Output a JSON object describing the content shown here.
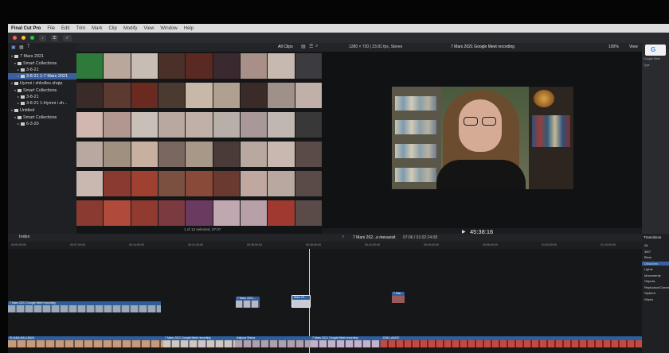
{
  "menubar": {
    "app": "Final Cut Pro",
    "items": [
      "File",
      "Edit",
      "Trim",
      "Mark",
      "Clip",
      "Modify",
      "View",
      "Window",
      "Help"
    ]
  },
  "libraries": [
    {
      "label": "7 Mars 2021",
      "type": "library",
      "selected": false
    },
    {
      "label": "Smart Collections",
      "type": "folder",
      "selected": false
    },
    {
      "label": "3-8-21",
      "type": "event",
      "selected": false
    },
    {
      "label": "3-8-21 1-7 Mars 2021",
      "type": "event",
      "selected": true
    },
    {
      "label": "Hymni i shkolles shqip",
      "type": "library",
      "selected": false
    },
    {
      "label": "Smart Collections",
      "type": "folder",
      "selected": false
    },
    {
      "label": "3-8-21",
      "type": "event",
      "selected": false
    },
    {
      "label": "3-8-21 1-Hymni i sh...",
      "type": "event",
      "selected": false
    },
    {
      "label": "Untitled",
      "type": "library",
      "selected": false
    },
    {
      "label": "Smart Collections",
      "type": "folder",
      "selected": false
    },
    {
      "label": "6-3-20",
      "type": "event",
      "selected": false
    }
  ],
  "browser": {
    "filter": "All Clips",
    "selection_status": "1 of 13 selected, 07:07"
  },
  "viewer": {
    "format": "1280 × 720 | 23.81 fps, Stereo",
    "title": "7 Mars 2021 Google Meet recording",
    "zoom": "100%",
    "view": "View",
    "timecode": "45:38:16"
  },
  "inspector": {
    "label1": "Google Meet",
    "label2": "Type"
  },
  "timeline": {
    "index": "Index",
    "project": "7 Mars 202...a mesuesit",
    "duration": "07:06 / 01:02:24:08",
    "ruler": [
      "00:00:00:00",
      "00:07:00:00",
      "00:14:00:00",
      "00:21:00:00",
      "00:28:00:00",
      "00:35:00:00",
      "00:42:00:00",
      "00:49:00:00",
      "00:56:00:00",
      "01:03:00:00",
      "01:10:00:00"
    ],
    "clips": [
      {
        "label": "7 Mars 2021 Google Meet recording",
        "color": "#2f5f9a"
      },
      {
        "label": "7 Mars 2021...",
        "color": "#2f5f9a"
      },
      {
        "label": "Mars 20...",
        "color": "#2f5f9a"
      },
      {
        "label": "7 Mar...",
        "color": "#2f5f9a"
      },
      {
        "label": "ELIANA NALLBANI",
        "color": "#2c5fa0"
      },
      {
        "label": "7 Mars 2021 Google Meet recording",
        "color": "#2c5fa0"
      },
      {
        "label": "Katjusa Shima",
        "color": "#2c5fa0"
      },
      {
        "label": "7 Mars 2021 Google Meet recording",
        "color": "#2c5fa0"
      },
      {
        "label": "JONI LAMCE",
        "color": "#2c5fa0"
      }
    ]
  },
  "transitions": {
    "title": "Transitions",
    "items": [
      "All",
      "360°",
      "Blurs",
      "Dissolves",
      "Lights",
      "Movements",
      "Objects",
      "Replicator/Clones",
      "Stylized",
      "Wipes"
    ]
  }
}
